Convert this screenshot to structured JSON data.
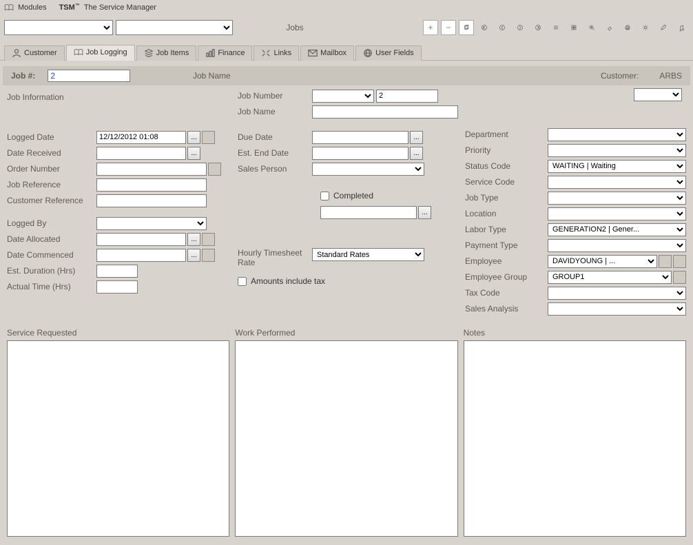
{
  "titlebar": {
    "modules": "Modules",
    "brand": "TSM",
    "tm": "™",
    "subtitle": "The Service Manager"
  },
  "toolbar": {
    "center": "Jobs"
  },
  "tabs": [
    {
      "label": "Customer"
    },
    {
      "label": "Job Logging"
    },
    {
      "label": "Job Items"
    },
    {
      "label": "Finance"
    },
    {
      "label": "Links"
    },
    {
      "label": "Mailbox"
    },
    {
      "label": "User Fields"
    }
  ],
  "header": {
    "jobNumLabel": "Job #:",
    "jobNum": "2",
    "jobNameLabel": "Job Name",
    "customerLabel": "Customer:",
    "customer": "ARBS"
  },
  "left": {
    "section": "Job Information",
    "loggedDateLbl": "Logged Date",
    "loggedDate": "12/12/2012 01:08",
    "dateReceivedLbl": "Date Received",
    "dateReceived": "",
    "orderNumberLbl": "Order Number",
    "orderNumber": "",
    "jobRefLbl": "Job Reference",
    "jobRef": "",
    "custRefLbl": "Customer Reference",
    "custRef": "",
    "loggedByLbl": "Logged By",
    "loggedBy": "",
    "dateAllocLbl": "Date Allocated",
    "dateAlloc": "",
    "dateCommLbl": "Date Commenced",
    "dateComm": "",
    "estDurLbl": "Est. Duration (Hrs)",
    "estDur": "",
    "actualTimeLbl": "Actual Time (Hrs)",
    "actualTime": ""
  },
  "mid": {
    "jobNumberLbl": "Job Number",
    "jobNumber": "2",
    "jobNameLbl": "Job Name",
    "jobName": "",
    "dueDateLbl": "Due Date",
    "dueDate": "",
    "estEndLbl": "Est. End Date",
    "estEnd": "",
    "salesPersonLbl": "Sales Person",
    "salesPerson": "",
    "completedLbl": "Completed",
    "completedDate": "",
    "hourlyLbl": "Hourly Timesheet Rate",
    "hourlyTop": "Hourly Timesheet",
    "hourlyBot": "Rate",
    "hourlyVal": "Standard Rates",
    "amountsTaxLbl": "Amounts include tax"
  },
  "right": {
    "departmentLbl": "Department",
    "department": "",
    "priorityLbl": "Priority",
    "priority": "",
    "statusLbl": "Status Code",
    "status": "WAITING | Waiting",
    "serviceLbl": "Service Code",
    "service": "",
    "jobTypeLbl": "Job Type",
    "jobType": "",
    "locationLbl": "Location",
    "location": "",
    "laborLbl": "Labor Type",
    "labor": "GENERATION2 | Gener...",
    "paymentLbl": "Payment Type",
    "payment": "",
    "employeeLbl": "Employee",
    "employee": "DAVIDYOUNG | ...",
    "empGroupLbl": "Employee Group",
    "empGroup": "GROUP1",
    "taxLbl": "Tax Code",
    "tax": "",
    "salesAnLbl": "Sales Analysis",
    "salesAn": ""
  },
  "bottom": {
    "serviceReqLbl": "Service Requested",
    "workPerfLbl": "Work Performed",
    "notesLbl": "Notes"
  }
}
